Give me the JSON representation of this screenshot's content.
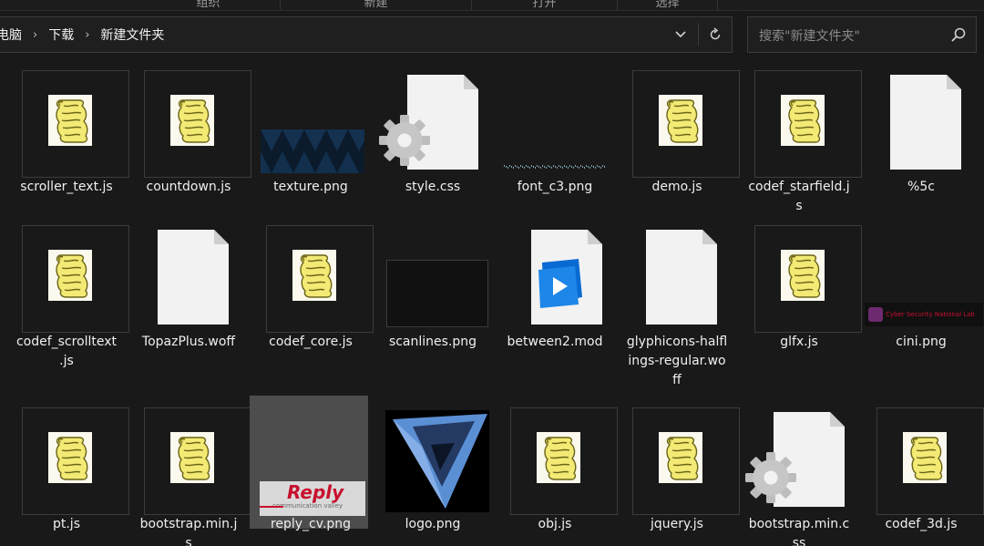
{
  "ribbon": {
    "groups": [
      "组织",
      "新建",
      "打开",
      "选择"
    ]
  },
  "address": {
    "crumbs": [
      "电脑",
      "下载",
      "新建文件夹"
    ]
  },
  "search": {
    "placeholder": "搜索\"新建文件夹\""
  },
  "files": [
    {
      "name": "scroller_text.js",
      "kind": "js"
    },
    {
      "name": "countdown.js",
      "kind": "js"
    },
    {
      "name": "texture.png",
      "kind": "texture"
    },
    {
      "name": "style.css",
      "kind": "css"
    },
    {
      "name": "font_c3.png",
      "kind": "font"
    },
    {
      "name": "demo.js",
      "kind": "js"
    },
    {
      "name": "codef_starfield.j\ns",
      "kind": "js"
    },
    {
      "name": "%5c",
      "kind": "blank"
    },
    {
      "name": "codef_scrolltext\n.js",
      "kind": "js"
    },
    {
      "name": "TopazPlus.woff",
      "kind": "blank"
    },
    {
      "name": "codef_core.js",
      "kind": "js"
    },
    {
      "name": "scanlines.png",
      "kind": "scanlines"
    },
    {
      "name": "between2.mod",
      "kind": "mod"
    },
    {
      "name": "glyphicons-halfl\nings-regular.wo\nff",
      "kind": "blank"
    },
    {
      "name": "glfx.js",
      "kind": "js"
    },
    {
      "name": "cini.png",
      "kind": "cini",
      "thumb_text": "Cyber Security National Lab"
    },
    {
      "name": "pt.js",
      "kind": "js"
    },
    {
      "name": "bootstrap.min.j\ns",
      "kind": "js"
    },
    {
      "name": "reply_cv.png",
      "kind": "reply",
      "selected": true,
      "thumb_text": "Reply",
      "thumb_subtext": "communication valley"
    },
    {
      "name": "logo.png",
      "kind": "logo"
    },
    {
      "name": "obj.js",
      "kind": "js"
    },
    {
      "name": "jquery.js",
      "kind": "js"
    },
    {
      "name": "bootstrap.min.c\nss",
      "kind": "css"
    },
    {
      "name": "codef_3d.js",
      "kind": "js"
    }
  ],
  "colors": {
    "background": "#191919",
    "selected": "#4d4d4d",
    "accent_blue": "#0a6ad3",
    "reply_red": "#c8102e"
  }
}
